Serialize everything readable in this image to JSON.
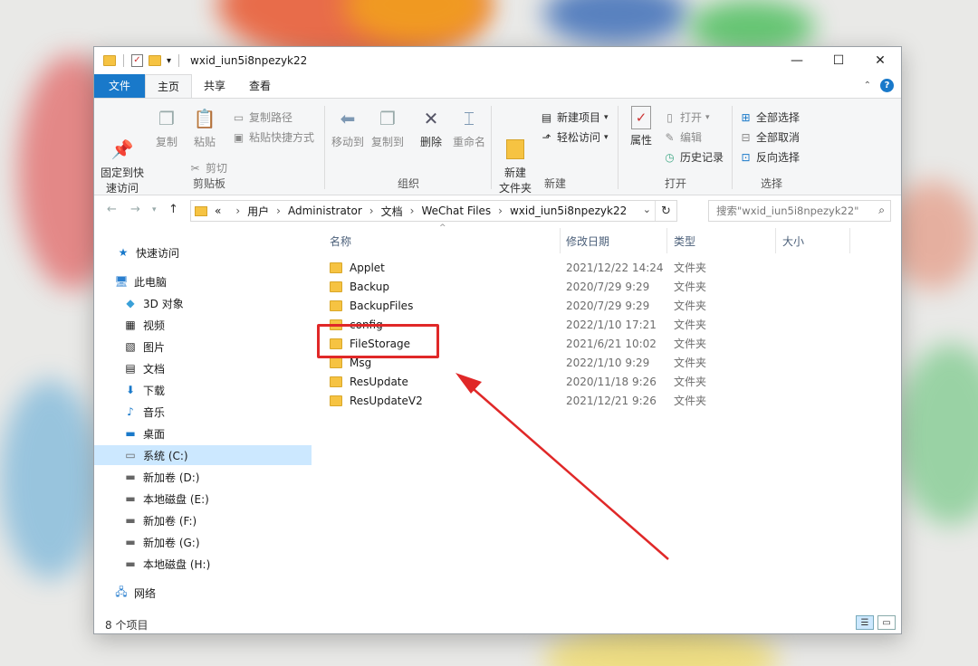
{
  "window": {
    "title": "wxid_iun5i8npezyk22",
    "controls": {
      "minimize": "—",
      "maximize": "☐",
      "close": "✕"
    }
  },
  "ribbon_tabs": [
    "文件",
    "主页",
    "共享",
    "查看"
  ],
  "ribbon": {
    "clipboard": {
      "pin_label": "固定到快\n速访问",
      "copy_label": "复制",
      "paste_label": "粘贴",
      "copy_path": "复制路径",
      "paste_shortcut": "粘贴快捷方式",
      "cut": "剪切",
      "group_label": "剪贴板"
    },
    "organize": {
      "move_to": "移动到",
      "copy_to": "复制到",
      "delete": "删除",
      "rename": "重命名",
      "group_label": "组织"
    },
    "new": {
      "new_folder": "新建\n文件夹",
      "new_item": "新建项目",
      "easy_access": "轻松访问",
      "group_label": "新建"
    },
    "open": {
      "properties": "属性",
      "open": "打开",
      "edit": "编辑",
      "history": "历史记录",
      "group_label": "打开"
    },
    "select": {
      "select_all": "全部选择",
      "select_none": "全部取消",
      "invert": "反向选择",
      "group_label": "选择"
    }
  },
  "address": {
    "prefix": "«",
    "crumbs": [
      "用户",
      "Administrator",
      "文档",
      "WeChat Files",
      "wxid_iun5i8npezyk22"
    ],
    "search_placeholder": "搜索\"wxid_iun5i8npezyk22\""
  },
  "nav_pane": [
    {
      "label": "快速访问",
      "icon": "star-icon"
    },
    {
      "label": "此电脑",
      "icon": "computer-icon"
    },
    {
      "label": "3D 对象",
      "icon": "cube-icon"
    },
    {
      "label": "视频",
      "icon": "video-icon"
    },
    {
      "label": "图片",
      "icon": "picture-icon"
    },
    {
      "label": "文档",
      "icon": "document-icon"
    },
    {
      "label": "下载",
      "icon": "download-icon"
    },
    {
      "label": "音乐",
      "icon": "music-icon"
    },
    {
      "label": "桌面",
      "icon": "desktop-icon"
    },
    {
      "label": "系统 (C:)",
      "icon": "drive-icon",
      "selected": true
    },
    {
      "label": "新加卷 (D:)",
      "icon": "drive-icon"
    },
    {
      "label": "本地磁盘 (E:)",
      "icon": "drive-icon"
    },
    {
      "label": "新加卷 (F:)",
      "icon": "drive-icon"
    },
    {
      "label": "新加卷 (G:)",
      "icon": "drive-icon"
    },
    {
      "label": "本地磁盘 (H:)",
      "icon": "drive-icon"
    },
    {
      "label": "网络",
      "icon": "network-icon"
    }
  ],
  "columns": [
    "名称",
    "修改日期",
    "类型",
    "大小"
  ],
  "files": [
    {
      "name": "Applet",
      "date": "2021/12/22 14:24",
      "type": "文件夹"
    },
    {
      "name": "Backup",
      "date": "2020/7/29 9:29",
      "type": "文件夹"
    },
    {
      "name": "BackupFiles",
      "date": "2020/7/29 9:29",
      "type": "文件夹"
    },
    {
      "name": "config",
      "date": "2022/1/10 17:21",
      "type": "文件夹"
    },
    {
      "name": "FileStorage",
      "date": "2021/6/21 10:02",
      "type": "文件夹"
    },
    {
      "name": "Msg",
      "date": "2022/1/10 9:29",
      "type": "文件夹"
    },
    {
      "name": "ResUpdate",
      "date": "2020/11/18 9:26",
      "type": "文件夹"
    },
    {
      "name": "ResUpdateV2",
      "date": "2021/12/21 9:26",
      "type": "文件夹"
    }
  ],
  "status": {
    "item_count": "8 个项目"
  },
  "annotation": {
    "highlight_color": "#e02828"
  }
}
